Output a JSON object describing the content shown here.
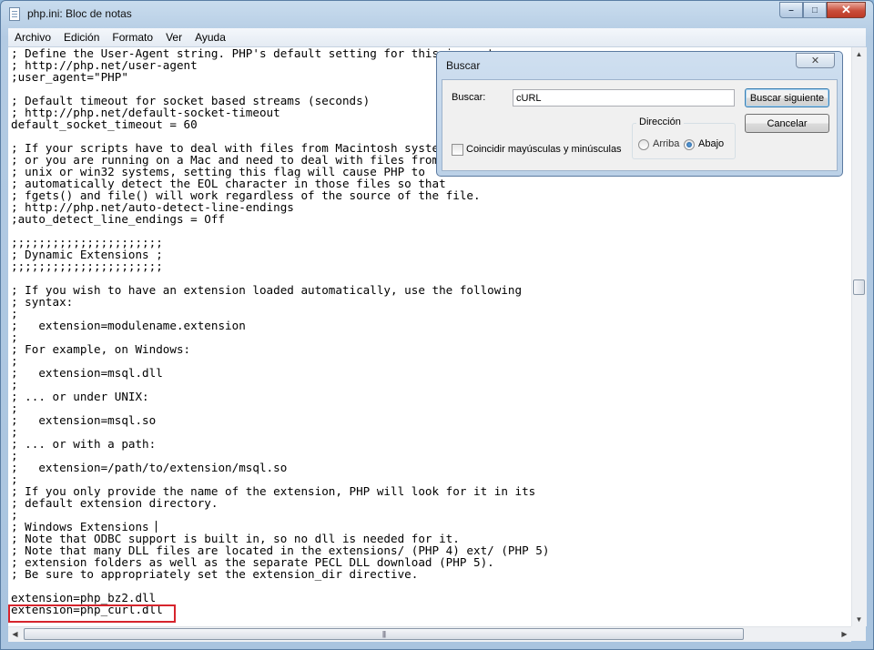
{
  "window": {
    "title": "php.ini: Bloc de notas",
    "minimize_glyph": "–",
    "maximize_glyph": "□",
    "close_glyph": "✕"
  },
  "menu": [
    "Archivo",
    "Edición",
    "Formato",
    "Ver",
    "Ayuda"
  ],
  "editor": {
    "lines": [
      "; Define the User-Agent string. PHP's default setting for this is empty.",
      "; http://php.net/user-agent",
      ";user_agent=\"PHP\"",
      "",
      "; Default timeout for socket based streams (seconds)",
      "; http://php.net/default-socket-timeout",
      "default_socket_timeout = 60",
      "",
      "; If your scripts have to deal with files from Macintosh systems,",
      "; or you are running on a Mac and need to deal with files from",
      "; unix or win32 systems, setting this flag will cause PHP to",
      "; automatically detect the EOL character in those files so that",
      "; fgets() and file() will work regardless of the source of the file.",
      "; http://php.net/auto-detect-line-endings",
      ";auto_detect_line_endings = Off",
      "",
      ";;;;;;;;;;;;;;;;;;;;;;",
      "; Dynamic Extensions ;",
      ";;;;;;;;;;;;;;;;;;;;;;",
      "",
      "; If you wish to have an extension loaded automatically, use the following",
      "; syntax:",
      ";",
      ";   extension=modulename.extension",
      ";",
      "; For example, on Windows:",
      ";",
      ";   extension=msql.dll",
      ";",
      "; ... or under UNIX:",
      ";",
      ";   extension=msql.so",
      ";",
      "; ... or with a path:",
      ";",
      ";   extension=/path/to/extension/msql.so",
      ";",
      "; If you only provide the name of the extension, PHP will look for it in its",
      "; default extension directory.",
      ";",
      "; Windows Extensions",
      "; Note that ODBC support is built in, so no dll is needed for it.",
      "; Note that many DLL files are located in the extensions/ (PHP 4) ext/ (PHP 5)",
      "; extension folders as well as the separate PECL DLL download (PHP 5).",
      "; Be sure to appropriately set the extension_dir directive.",
      "",
      "extension=php_bz2.dll",
      "extension=php_curl.dll"
    ]
  },
  "scrollbars": {
    "up_arrow": "▲",
    "down_arrow": "▼",
    "left_arrow": "◀",
    "right_arrow": "▶",
    "grip": "|||"
  },
  "find_dialog": {
    "title": "Buscar",
    "close_glyph": "✕",
    "find_label": "Buscar:",
    "find_value": "cURL",
    "find_next_button": "Buscar siguiente",
    "cancel_button": "Cancelar",
    "direction_label": "Dirección",
    "direction_up": "Arriba",
    "direction_down": "Abajo",
    "direction_selected": "Abajo",
    "match_case_label": "Coincidir mayúsculas y minúsculas",
    "match_case_checked": false
  },
  "colors": {
    "highlight_border": "#d6242c",
    "title_bar": "#b3cbe3"
  }
}
